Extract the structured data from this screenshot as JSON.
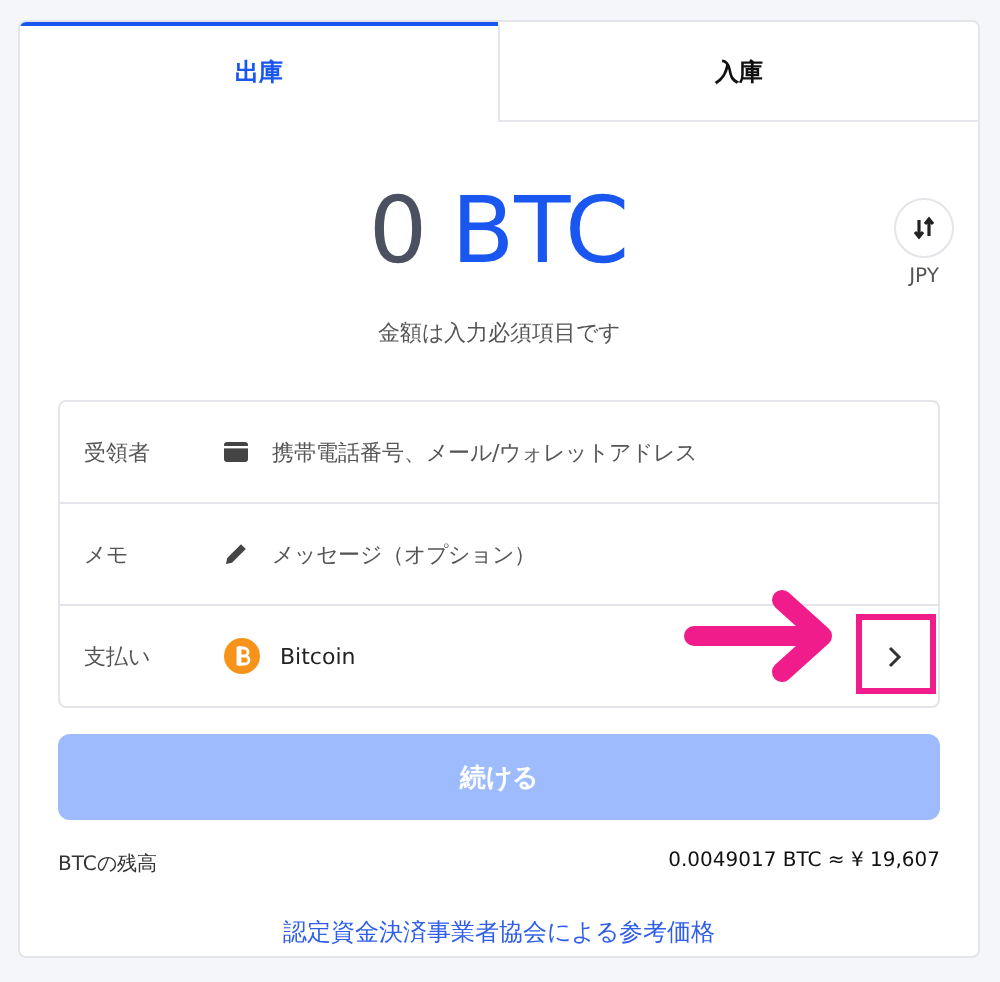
{
  "tabs": [
    {
      "label": "出庫",
      "selected": true
    },
    {
      "label": "入庫",
      "selected": false
    }
  ],
  "amount": {
    "value": "0",
    "currency": "BTC",
    "toggle_label": "JPY",
    "hint": "金額は入力必須項目です"
  },
  "fields": [
    {
      "kind": "recipient",
      "label": "受領者",
      "placeholder": "携帯電話番号、メール/ウォレットアドレス"
    },
    {
      "kind": "memo",
      "label": "メモ",
      "placeholder": "メッセージ（オプション）"
    },
    {
      "kind": "payment",
      "label": "支払い",
      "value": "Bitcoin"
    }
  ],
  "continue_button": {
    "label": "続ける",
    "disabled": true
  },
  "balance": {
    "label": "BTCの残高",
    "value": "0.0049017 BTC ≈ ¥ 19,607"
  },
  "reference_link": "認定資金決済事業者協会による参考価格"
}
